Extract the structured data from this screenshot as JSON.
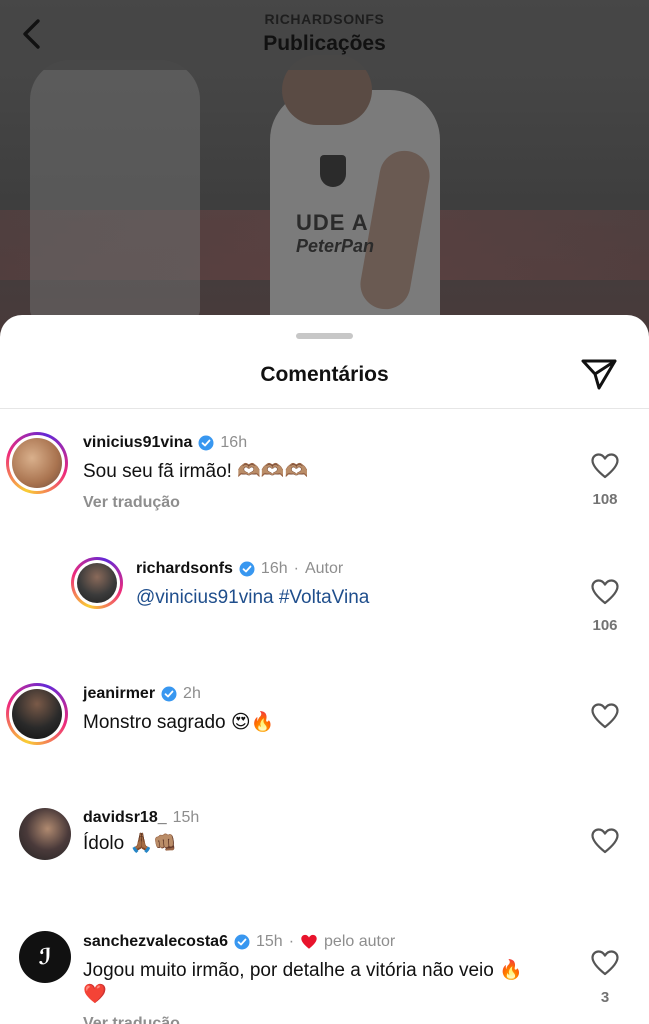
{
  "header": {
    "username": "RICHARDSONFS",
    "title": "Publicações"
  },
  "background_post": {
    "shirt_text_1": "UDE A",
    "shirt_text_2": "PeterPan"
  },
  "sheet": {
    "title": "Comentários"
  },
  "comments": [
    {
      "username": "vinicius91vina",
      "verified": true,
      "time": "16h",
      "text": "Sou seu fã irmão! 🫶🏽🫶🏽🫶🏽",
      "translate": "Ver tradução",
      "likes": "108"
    },
    {
      "username": "richardsonfs",
      "verified": true,
      "time": "16h",
      "tag": "Autor",
      "text_mention": "@vinicius91vina #VoltaVina",
      "likes": "106"
    },
    {
      "username": "jeanirmer",
      "verified": true,
      "time": "2h",
      "text": "Monstro sagrado 😍🔥"
    },
    {
      "username": "davidsr18_",
      "verified": false,
      "time": "15h",
      "text": "Ídolo 🙏🏾👊🏽"
    },
    {
      "username": "sanchezvalecosta6",
      "verified": true,
      "time": "15h",
      "tag": "pelo autor",
      "text": "Jogou muito irmão, por detalhe a vitória não veio 🔥",
      "text_line2": "❤️",
      "translate": "Ver tradução",
      "likes": "3"
    }
  ],
  "colors": {
    "accent_blue": "#1f4e8c",
    "verified_blue": "#3897f0",
    "muted": "#8e8e8e"
  }
}
